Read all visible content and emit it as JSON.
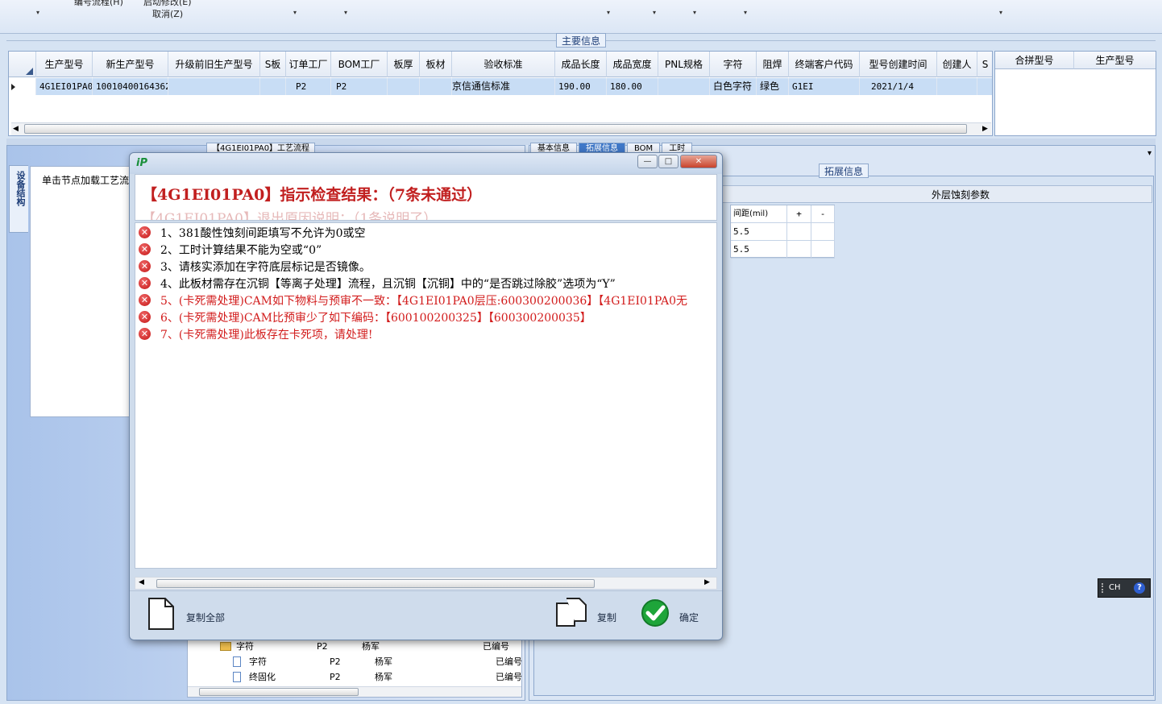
{
  "toolbar": {
    "top_items": [
      "编号流程(H)",
      "启动修改(E)"
    ],
    "cancel": "取消(Z)",
    "dropdown_glyph": "▾"
  },
  "main_info": {
    "title": "主要信息",
    "columns": [
      "生产型号",
      "新生产型号",
      "升级前旧生产型号",
      "S板",
      "订单工厂",
      "BOM工厂",
      "板厚",
      "板材",
      "验收标准",
      "成品长度",
      "成品宽度",
      "PNL规格",
      "字符",
      "阻焊",
      "终端客户代码",
      "型号创建时间",
      "创建人",
      "S"
    ],
    "row": [
      "4G1EI01PA0",
      "10010400164362",
      "",
      "",
      "P2",
      "P2",
      "",
      "",
      "京信通信标准",
      "190.00",
      "180.00",
      "",
      "白色字符",
      "绿色",
      "G1EI",
      "2021/1/4",
      "",
      ""
    ],
    "right_columns": [
      "合拼型号",
      "生产型号"
    ]
  },
  "left": {
    "vertical_tab": "设备结构",
    "tab": "【4G1EI01PA0】工艺流程",
    "caption": "单击节点加载工艺流",
    "tree": [
      {
        "name": "字符",
        "factory": "P2",
        "person": "杨军",
        "status": "已编号"
      },
      {
        "name": "字符",
        "factory": "P2",
        "person": "杨军",
        "status": "已编号"
      },
      {
        "name": "终固化",
        "factory": "P2",
        "person": "杨军",
        "status": "已编号"
      }
    ]
  },
  "right": {
    "tabs": [
      "基本信息",
      "拓展信息",
      "BOM",
      "工时"
    ],
    "ext_title": "拓展信息",
    "outer_etch": "外层蚀刻参数",
    "param_headers": [
      "间距(mil)",
      "+",
      "-"
    ],
    "param_rows": [
      [
        "5.5",
        "",
        ""
      ],
      [
        "5.5",
        "",
        ""
      ]
    ]
  },
  "ime": {
    "label": "CH"
  },
  "dialog": {
    "title": "【4G1EI01PA0】指示检查结果：（7条未通过）",
    "ghost": "【4G1EI01PA0】退出原因说明：（1条说明了）",
    "items": [
      {
        "text": "1、381酸性蚀刻间距填写不允许为0或空",
        "color": "#111111"
      },
      {
        "text": "2、工时计算结果不能为空或“0”",
        "color": "#111111"
      },
      {
        "text": "3、请核实添加在字符底层标记是否镜像。",
        "color": "#111111"
      },
      {
        "text": "4、此板材需存在沉铜【等离子处理】流程，且沉铜【沉铜】中的“是否跳过除胶”选项为“Y”",
        "color": "#111111"
      },
      {
        "text": "5、(卡死需处理)CAM如下物料与预审不一致：【4G1EI01PA0层压:600300200036】【4G1EI01PA0无",
        "color": "#d21c1c"
      },
      {
        "text": "6、(卡死需处理)CAM比预审少了如下编码：【600100200325】【600300200035】",
        "color": "#d21c1c"
      },
      {
        "text": "7、(卡死需处理)此板存在卡死项，请处理!",
        "color": "#d21c1c"
      }
    ],
    "copy_all": "复制全部",
    "copy": "复制",
    "ok": "确定",
    "win_min": "—",
    "win_max": "□",
    "win_close": "✕",
    "error_glyph": "✕"
  }
}
